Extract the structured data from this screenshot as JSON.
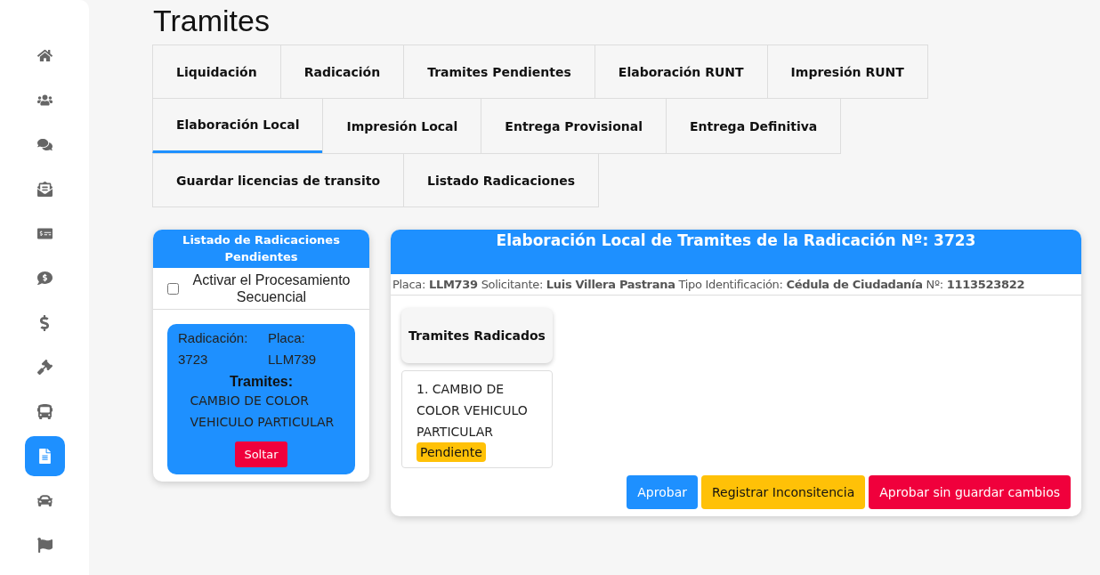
{
  "sidebar": {
    "items": [
      {
        "selected": false
      },
      {
        "selected": false
      },
      {
        "selected": false
      },
      {
        "selected": false
      },
      {
        "selected": false
      },
      {
        "selected": false
      },
      {
        "selected": false
      },
      {
        "selected": false
      },
      {
        "selected": false
      },
      {
        "selected": true
      },
      {
        "selected": false
      },
      {
        "selected": false
      }
    ]
  },
  "page_title": "Tramites",
  "tab_rows": [
    [
      {
        "label": "Liquidación",
        "selected": false
      },
      {
        "label": "Radicación",
        "selected": false
      },
      {
        "label": "Tramites Pendientes",
        "selected": false
      },
      {
        "label": "Elaboración RUNT",
        "selected": false
      },
      {
        "label": "Impresión RUNT",
        "selected": false
      }
    ],
    [
      {
        "label": "Elaboración Local",
        "selected": true
      },
      {
        "label": "Impresión Local",
        "selected": false
      },
      {
        "label": "Entrega Provisional",
        "selected": false
      },
      {
        "label": "Entrega Definitiva",
        "selected": false
      }
    ],
    [
      {
        "label": "Guardar licencias de transito",
        "selected": false
      },
      {
        "label": "Listado Radicaciones",
        "selected": false
      }
    ]
  ],
  "pending_panel": {
    "title": "Listado de Radicaciones Pendientes",
    "sequential_checkbox": {
      "label": "Activar el Procesamiento Secuencial",
      "checked": false
    },
    "cards": [
      {
        "radicacion_label": "Radicación:",
        "radicacion": "3723",
        "placa_label": "Placa:",
        "placa": "LLM739",
        "tramites_label": "Tramites:",
        "tramites": "CAMBIO DE COLOR VEHICULO PARTICULAR",
        "button": "Soltar"
      }
    ]
  },
  "detail_panel": {
    "title": "Elaboración Local de Tramites de la Radicación Nº: 3723",
    "info": [
      {
        "label": "Placa:",
        "value": "LLM739"
      },
      {
        "label": "Solicitante:",
        "value": "Luis Villera Pastrana"
      },
      {
        "label": "Tipo Identificación:",
        "value": "Cédula de Ciudadanía"
      },
      {
        "label": "Nº:",
        "value": "1113523822"
      }
    ],
    "tramites_header": "Tramites Radicados",
    "tramites": [
      {
        "text": "1. CAMBIO DE COLOR VEHICULO PARTICULAR",
        "status": "Pendiente"
      }
    ],
    "buttons": [
      {
        "label": "Aprobar",
        "kind": "primary"
      },
      {
        "label": "Registrar Inconsitencia",
        "kind": "warning"
      },
      {
        "label": "Aprobar sin guardar cambios",
        "kind": "danger"
      }
    ]
  }
}
